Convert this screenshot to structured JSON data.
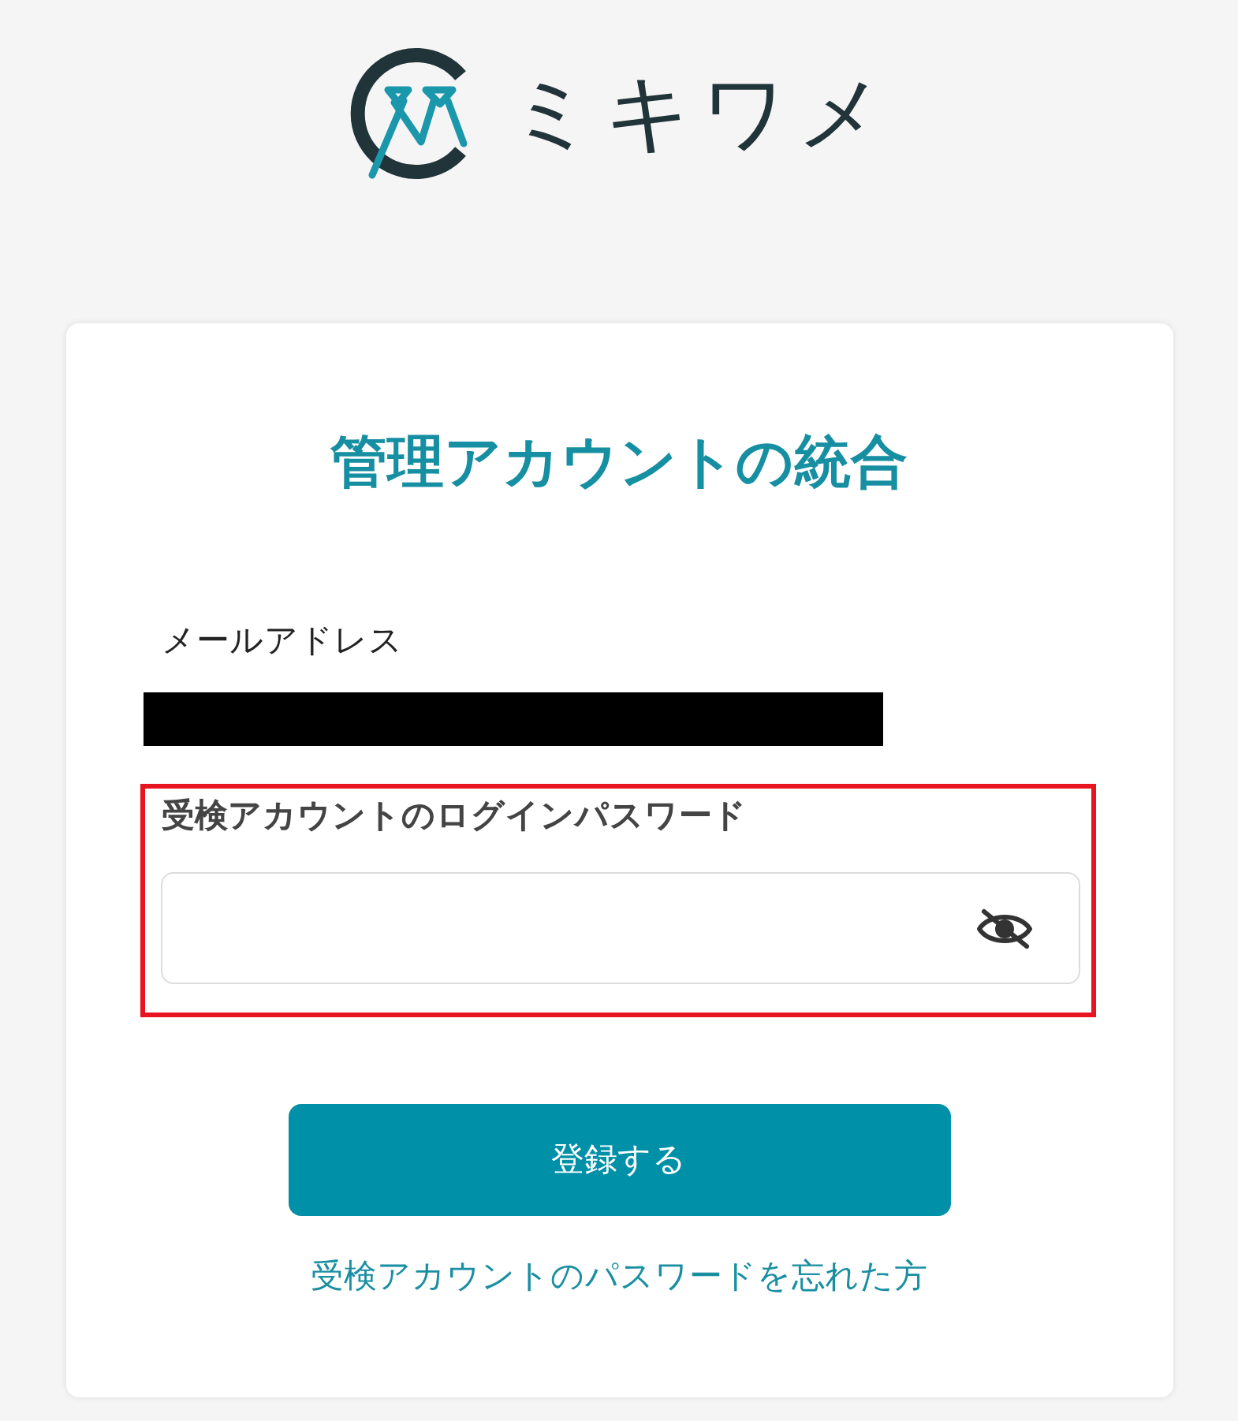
{
  "logo": {
    "text": "ミキワメ"
  },
  "card": {
    "title": "管理アカウントの統合",
    "email": {
      "label": "メールアドレス",
      "redacted": true
    },
    "password": {
      "label": "受検アカウントのログインパスワード",
      "highlighted": true,
      "masked": true
    },
    "submit_button": {
      "label": "登録する"
    },
    "forgot_link": {
      "label": "受検アカウントのパスワードを忘れた方"
    }
  }
}
